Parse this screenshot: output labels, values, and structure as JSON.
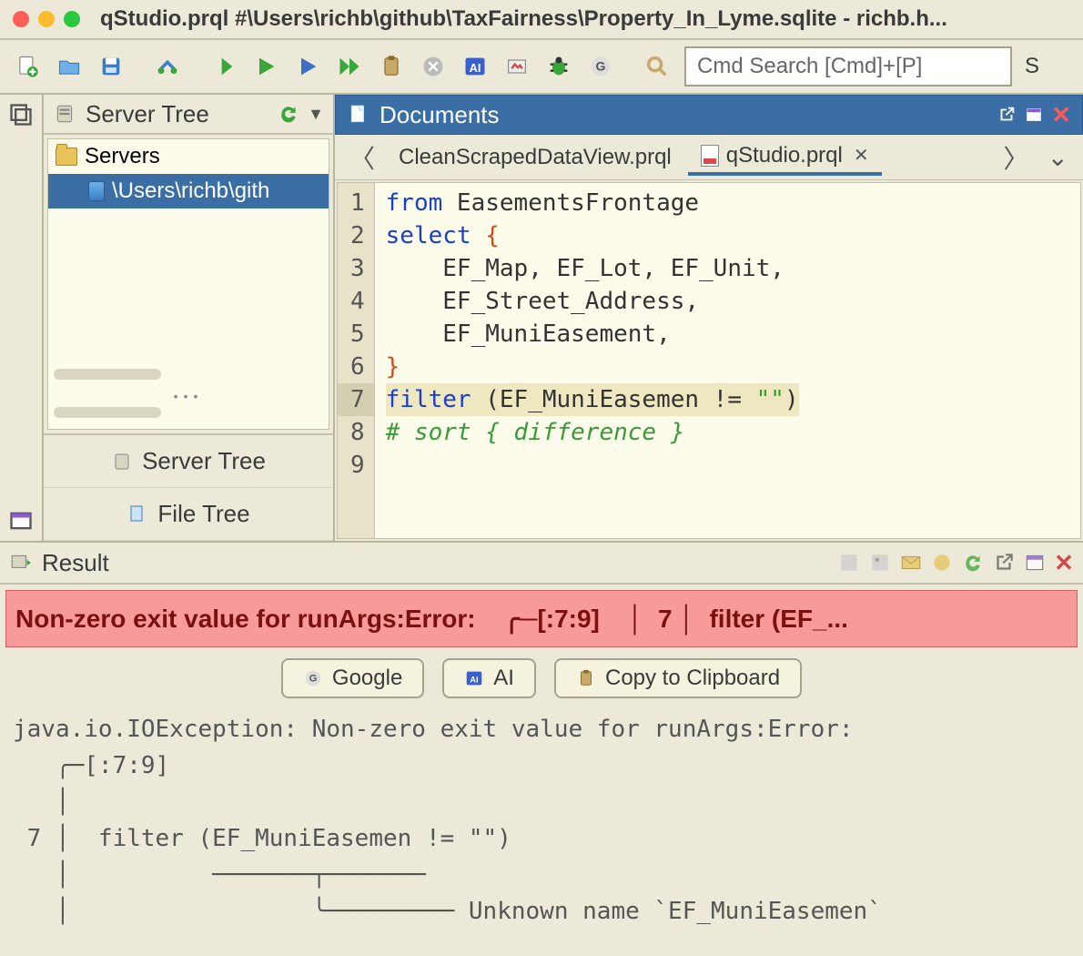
{
  "window": {
    "title": "qStudio.prql #\\Users\\richb\\github\\TaxFairness\\Property_In_Lyme.sqlite - richb.h..."
  },
  "toolbar": {
    "search_placeholder": "Cmd Search [Cmd]+[P]",
    "tail_hint": "S"
  },
  "sidebar": {
    "header": "Server Tree",
    "top_collapse_icon": "stack-icon",
    "tree": {
      "root_label": "Servers",
      "selected_path": "\\Users\\richb\\gith"
    },
    "tabs": {
      "server_tree": "Server Tree",
      "file_tree": "File Tree"
    }
  },
  "documents": {
    "panel_title": "Documents",
    "tabs": [
      {
        "label": "CleanScrapedDataView.prql",
        "active": false,
        "dirty": false
      },
      {
        "label": "qStudio.prql",
        "active": true,
        "dirty": true
      }
    ],
    "editor": {
      "line_numbers": [
        "1",
        "2",
        "3",
        "4",
        "5",
        "6",
        "7",
        "8",
        "9"
      ],
      "highlight_line": 7,
      "tokens_html_lines": [
        [
          {
            "t": "from",
            "c": "kw"
          },
          {
            "t": " EasementsFrontage",
            "c": "ident"
          }
        ],
        [
          {
            "t": "select",
            "c": "kw"
          },
          {
            "t": " ",
            "c": ""
          },
          {
            "t": "{",
            "c": "br"
          }
        ],
        [
          {
            "t": "    EF_Map, EF_Lot, EF_Unit,",
            "c": "ident"
          }
        ],
        [
          {
            "t": "    EF_Street_Address,",
            "c": "ident"
          }
        ],
        [
          {
            "t": "    EF_MuniEasement,",
            "c": "ident"
          }
        ],
        [
          {
            "t": "}",
            "c": "br"
          }
        ],
        [
          {
            "t": "filter",
            "c": "kw"
          },
          {
            "t": " (EF_MuniEasemen != ",
            "c": "ident"
          },
          {
            "t": "\"\"",
            "c": "str"
          },
          {
            "t": ")",
            "c": "ident"
          }
        ],
        [
          {
            "t": "# sort { difference }",
            "c": "cm"
          }
        ],
        [
          {
            "t": "",
            "c": ""
          }
        ]
      ]
    }
  },
  "result": {
    "header": "Result",
    "error_banner": "Non-zero exit value for runArgs:Error:    ╭─[:7:9]    │  7 │  filter (EF_...",
    "buttons": {
      "google": "Google",
      "ai": "AI",
      "copy": "Copy to Clipboard"
    },
    "stack": "java.io.IOException: Non-zero exit value for runArgs:Error: \n   ╭─[:7:9]\n   │\n 7 │  filter (EF_MuniEasemen != \"\")\n   │          ───────┬───────  \n   │                 ╰───────── Unknown name `EF_MuniEasemen`"
  }
}
